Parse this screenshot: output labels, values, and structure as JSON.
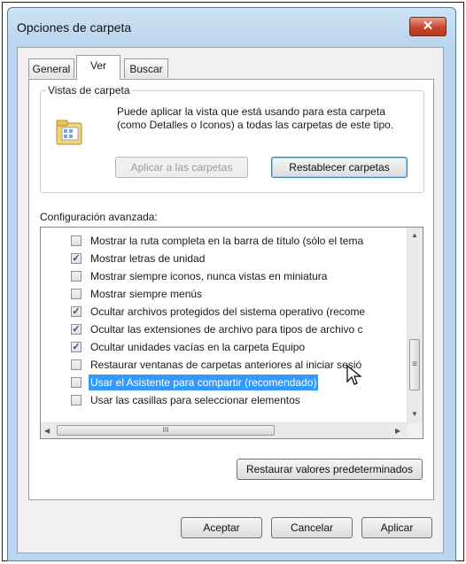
{
  "window": {
    "title": "Opciones de carpeta",
    "close_glyph": "✕"
  },
  "tabs": [
    {
      "label": "General",
      "active": false
    },
    {
      "label": "Ver",
      "active": true
    },
    {
      "label": "Buscar",
      "active": false
    }
  ],
  "folder_views": {
    "group_label": "Vistas de carpeta",
    "description": "Puede aplicar la vista que está usando para esta carpeta (como Detalles o Iconos) a todas las carpetas de este tipo.",
    "icon": "folder-view-icon",
    "apply_button": "Aplicar a las carpetas",
    "reset_button": "Restablecer carpetas"
  },
  "advanced": {
    "label": "Configuración avanzada:",
    "items": [
      {
        "label": "Mostrar la ruta completa en la barra de título (sólo el tema",
        "checked": false
      },
      {
        "label": "Mostrar letras de unidad",
        "checked": true
      },
      {
        "label": "Mostrar siempre iconos, nunca vistas en miniatura",
        "checked": false
      },
      {
        "label": "Mostrar siempre menús",
        "checked": false
      },
      {
        "label": "Ocultar archivos protegidos del sistema operativo (recome",
        "checked": true
      },
      {
        "label": "Ocultar las extensiones de archivo para tipos de archivo c",
        "checked": true
      },
      {
        "label": "Ocultar unidades vacías en la carpeta Equipo",
        "checked": true
      },
      {
        "label": "Restaurar ventanas de carpetas anteriores al iniciar sesió",
        "checked": false
      },
      {
        "label": "Usar el Asistente para compartir (recomendado)",
        "checked": false,
        "selected": true
      },
      {
        "label": "Usar las casillas para seleccionar elementos",
        "checked": false
      }
    ],
    "check_glyph": "✓",
    "scroll_glyphs": {
      "up": "▲",
      "down": "▼",
      "left": "◀",
      "right": "▶",
      "grip": "≡",
      "hgrip": "III"
    }
  },
  "restore_defaults_button": "Restaurar valores predeterminados",
  "footer": {
    "ok": "Aceptar",
    "cancel": "Cancelar",
    "apply": "Aplicar"
  },
  "colors": {
    "selection": "#3399ff",
    "close_button": "#c7452c",
    "frame": "#bcd5ee"
  }
}
